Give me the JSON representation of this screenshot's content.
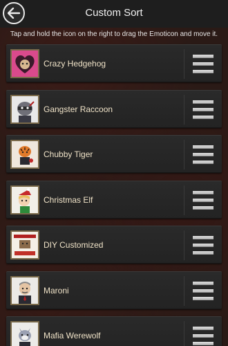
{
  "header": {
    "title": "Custom Sort",
    "back_icon": "back-arrow-icon"
  },
  "instruction": "Tap and hold the icon on the right to drag the Emoticon and move it.",
  "items": [
    {
      "label": "Crazy Hedgehog",
      "icon": "heart-hedgehog-icon"
    },
    {
      "label": "Gangster Raccoon",
      "icon": "raccoon-icon"
    },
    {
      "label": "Chubby Tiger",
      "icon": "tiger-icon"
    },
    {
      "label": "Christmas Elf",
      "icon": "elf-icon"
    },
    {
      "label": "DIY Customized",
      "icon": "diy-icon"
    },
    {
      "label": "Maroni",
      "icon": "maroni-icon"
    },
    {
      "label": "Mafia Werewolf",
      "icon": "werewolf-icon"
    }
  ],
  "colors": {
    "item_text": "#f0e3c8",
    "background": "#2a1a16",
    "row": "#262626",
    "handle": "#c8c8c8"
  }
}
